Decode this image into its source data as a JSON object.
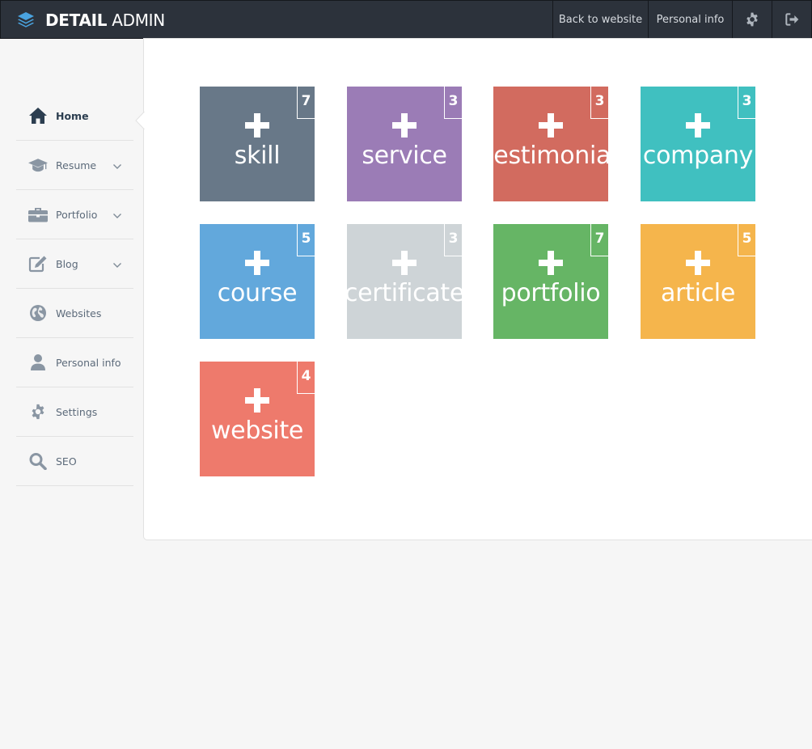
{
  "brand": {
    "bold": "DETAIL",
    "light": "ADMIN",
    "icon": "layers-icon",
    "color": "#4aa3df"
  },
  "topnav": {
    "back_label": "Back to website",
    "personal_label": "Personal info",
    "settings_icon": "gear-icon",
    "logout_icon": "sign-out-icon"
  },
  "sidebar": {
    "items": [
      {
        "label": "Home",
        "icon": "home-icon",
        "active": true
      },
      {
        "label": "Resume",
        "icon": "graduation-cap-icon",
        "expandable": true
      },
      {
        "label": "Portfolio",
        "icon": "briefcase-icon",
        "expandable": true
      },
      {
        "label": "Blog",
        "icon": "edit-icon",
        "expandable": true
      },
      {
        "label": "Websites",
        "icon": "globe-icon"
      },
      {
        "label": "Personal info",
        "icon": "user-icon"
      },
      {
        "label": "Settings",
        "icon": "gear-icon"
      },
      {
        "label": "SEO",
        "icon": "search-icon"
      }
    ]
  },
  "tiles": [
    {
      "name": "skill",
      "count": "7",
      "color": "#687888"
    },
    {
      "name": "service",
      "count": "3",
      "color": "#9b7cb6"
    },
    {
      "name": "testimonial",
      "count": "3",
      "color": "#d26b5f"
    },
    {
      "name": "company",
      "count": "3",
      "color": "#40c0c0"
    },
    {
      "name": "course",
      "count": "5",
      "color": "#62a8dc"
    },
    {
      "name": "certificate",
      "count": "3",
      "color": "#ced4d7"
    },
    {
      "name": "portfolio",
      "count": "7",
      "color": "#66b565"
    },
    {
      "name": "article",
      "count": "5",
      "color": "#f5b54c"
    },
    {
      "name": "website",
      "count": "4",
      "color": "#ee7a6c"
    }
  ]
}
